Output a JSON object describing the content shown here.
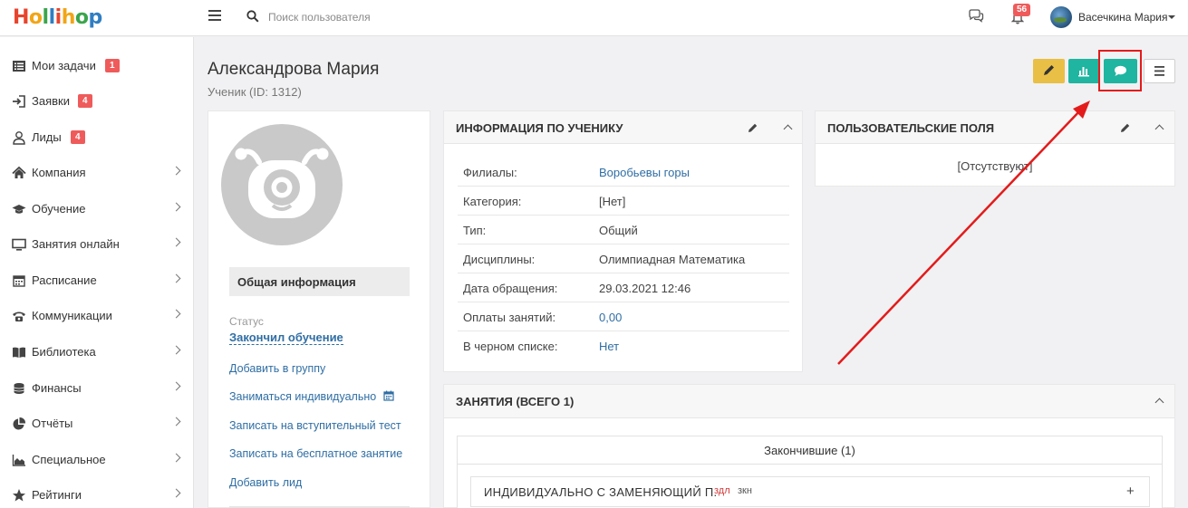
{
  "topbar": {
    "logo_parts": [
      {
        "text": "H",
        "color": "#e8442d"
      },
      {
        "text": "o",
        "color": "#f2a516"
      },
      {
        "text": "l",
        "color": "#3aa54b"
      },
      {
        "text": "l",
        "color": "#2f7ec2"
      },
      {
        "text": "i",
        "color": "#e8442d"
      },
      {
        "text": "h",
        "color": "#f2a516"
      },
      {
        "text": "o",
        "color": "#3aa54b"
      },
      {
        "text": "p",
        "color": "#2f7ec2"
      }
    ],
    "search_placeholder": "Поиск пользователя",
    "notifications_count": "56",
    "user_name": "Васечкина Мария"
  },
  "sidebar": {
    "items": [
      {
        "label": "Мои задачи",
        "icon": "list-icon",
        "badge": "1"
      },
      {
        "label": "Заявки",
        "icon": "sign-in-icon",
        "badge": "4"
      },
      {
        "label": "Лиды",
        "icon": "user-icon",
        "badge": "4"
      },
      {
        "label": "Компания",
        "icon": "home-icon"
      },
      {
        "label": "Обучение",
        "icon": "graduation-cap-icon"
      },
      {
        "label": "Занятия онлайн",
        "icon": "monitor-icon"
      },
      {
        "label": "Расписание",
        "icon": "calendar-icon"
      },
      {
        "label": "Коммуникации",
        "icon": "phone-icon"
      },
      {
        "label": "Библиотека",
        "icon": "book-icon"
      },
      {
        "label": "Финансы",
        "icon": "coins-icon"
      },
      {
        "label": "Отчёты",
        "icon": "pie-chart-icon"
      },
      {
        "label": "Специальное",
        "icon": "area-chart-icon"
      },
      {
        "label": "Рейтинги",
        "icon": "star-icon"
      }
    ]
  },
  "header": {
    "title": "Александрова Мария",
    "subtitle": "Ученик (ID: 1312)"
  },
  "profile": {
    "general_info_label": "Общая информация",
    "status_label": "Статус",
    "status_value": "Закончил обучение",
    "actions": [
      "Добавить в группу",
      "Заниматься индивидуально",
      "Записать на вступительный тест",
      "Записать на бесплатное занятие",
      "Добавить лид"
    ]
  },
  "student_info": {
    "title": "ИНФОРМАЦИЯ ПО УЧЕНИКУ",
    "rows": [
      {
        "key": "Филиалы:",
        "value": "Воробьевы горы",
        "link": true
      },
      {
        "key": "Категория:",
        "value": "[Нет]",
        "link": false
      },
      {
        "key": "Тип:",
        "value": "Общий",
        "link": false
      },
      {
        "key": "Дисциплины:",
        "value": "Олимпиадная Математика",
        "link": false
      },
      {
        "key": "Дата обращения:",
        "value": "29.03.2021 12:46",
        "link": false
      },
      {
        "key": "Оплаты занятий:",
        "value": "0,00",
        "link": true
      },
      {
        "key": "В черном списке:",
        "value": "Нет",
        "link": true
      }
    ]
  },
  "custom_fields": {
    "title": "ПОЛЬЗОВАТЕЛЬСКИЕ ПОЛЯ",
    "empty_text": "[Отсутствуют]"
  },
  "lessons": {
    "title": "ЗАНЯТИЯ (ВСЕГО 1)",
    "finished_title": "Закончившие (1)",
    "lesson_name": "ИНДИВИДУАЛЬНО С ЗАМЕНЯЮЩИЙ П.",
    "tag_1": "здл",
    "tag_2": "зкн",
    "expand_symbol": "+"
  },
  "colors": {
    "accent_teal": "#1fb5a0",
    "accent_yellow": "#e9bf46",
    "badge_red": "#ef5b5b",
    "link_blue": "#2f6ea4",
    "highlight_red": "#e31b1b"
  }
}
